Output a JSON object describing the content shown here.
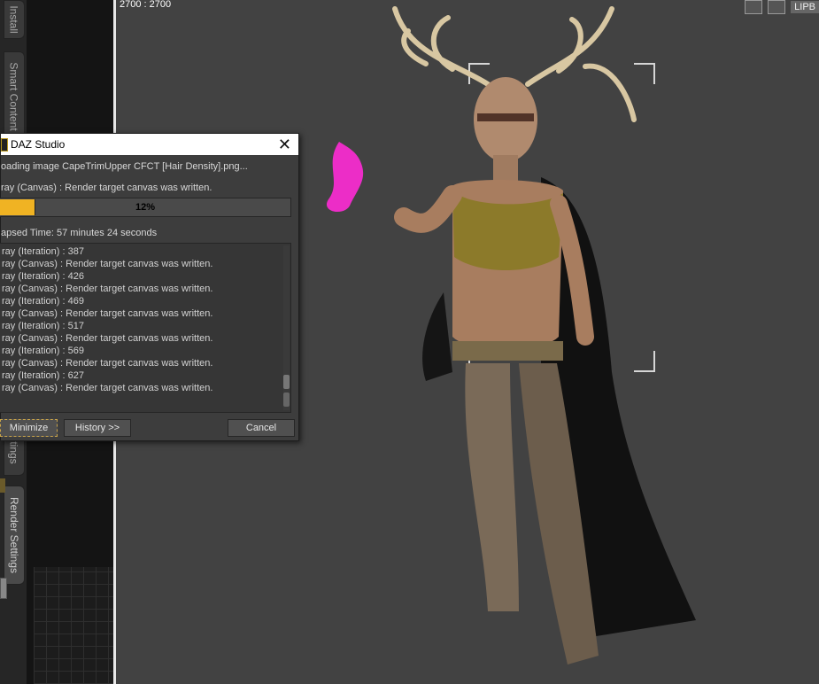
{
  "left_panel": {
    "tabs": [
      {
        "label": "Install"
      },
      {
        "label": "Smart Content"
      },
      {
        "label": "tings"
      },
      {
        "label": "Render Settings"
      }
    ]
  },
  "viewport": {
    "resolution_label": "2700 : 2700",
    "camera_label": "LIPB",
    "icons": [
      "render-preview-icon",
      "camera-icon",
      "layout-icon"
    ]
  },
  "dialog": {
    "title": "DAZ Studio",
    "status_line": "oading image CapeTrimUpper CFCT [Hair Density].png...",
    "sub_status": "ray (Canvas) : Render target canvas was written.",
    "progress": {
      "percent_label": "12%",
      "value": 12
    },
    "elapsed": "apsed Time:  57 minutes 24 seconds",
    "log": [
      "ray (Iteration) : 387",
      "ray (Canvas) : Render target canvas was written.",
      "ray (Iteration) : 426",
      "ray (Canvas) : Render target canvas was written.",
      "ray (Iteration) : 469",
      "ray (Canvas) : Render target canvas was written.",
      "ray (Iteration) : 517",
      "ray (Canvas) : Render target canvas was written.",
      "ray (Iteration) : 569",
      "ray (Canvas) : Render target canvas was written.",
      "ray (Iteration) : 627",
      "ray (Canvas) : Render target canvas was written."
    ],
    "buttons": {
      "minimize": "Minimize",
      "history": "History >>",
      "cancel": "Cancel"
    }
  },
  "colors": {
    "progress_fill": "#f0b323",
    "flame": "#ff2bd6",
    "viewport_bg": "#424242"
  }
}
